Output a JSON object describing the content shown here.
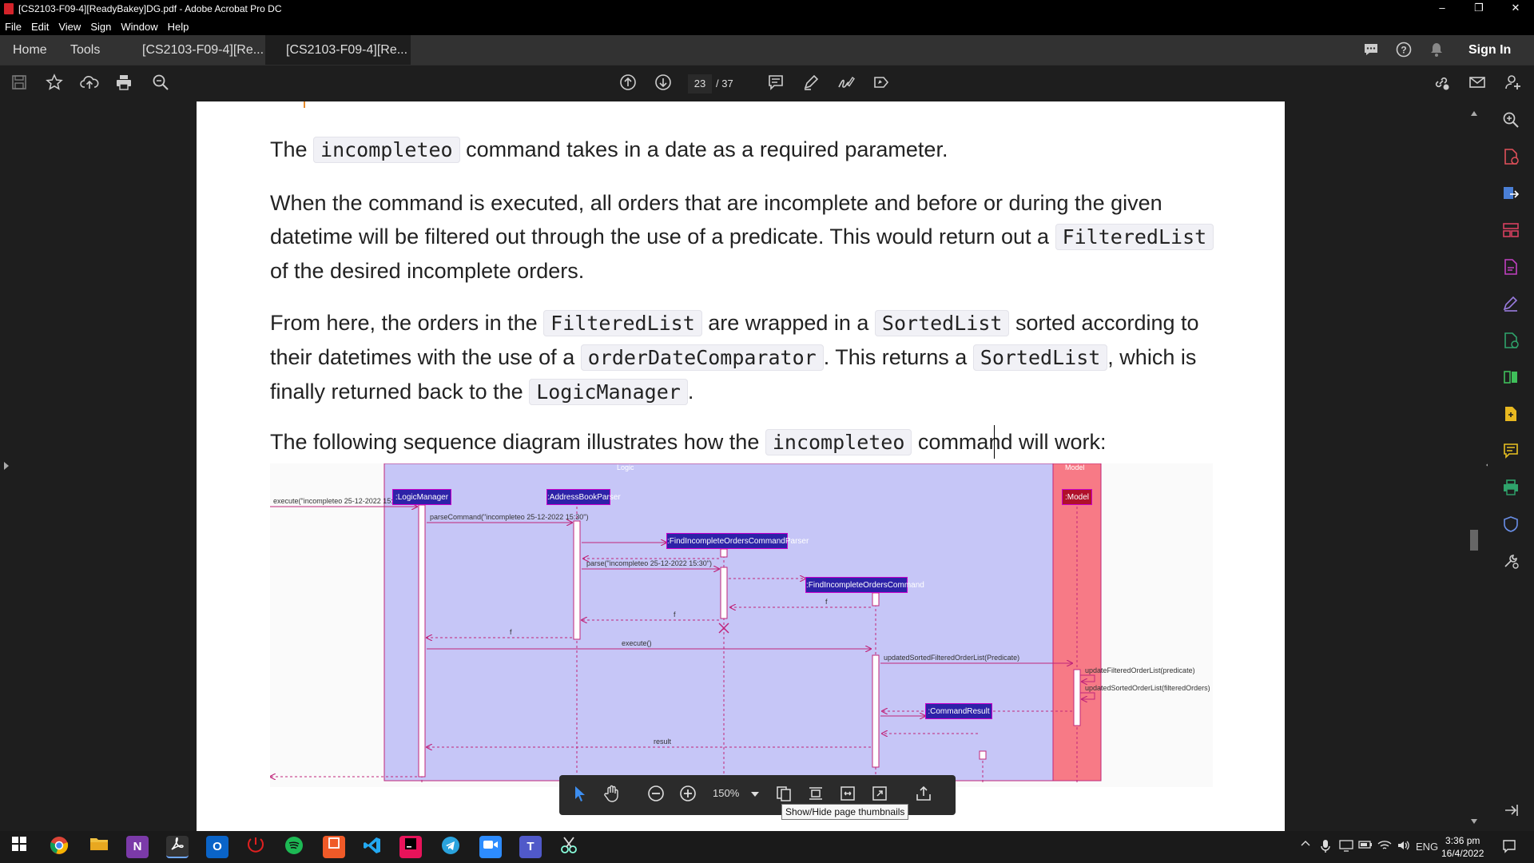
{
  "window": {
    "title": "[CS2103-F09-4][ReadyBakey]DG.pdf - Adobe Acrobat Pro DC",
    "controls": [
      "–",
      "❐",
      "✕"
    ]
  },
  "menu": [
    "File",
    "Edit",
    "View",
    "Sign",
    "Window",
    "Help"
  ],
  "tabs": {
    "home": "Home",
    "tools": "Tools",
    "doc1": "[CS2103-F09-4][Re...",
    "doc2": "[CS2103-F09-4][Re...",
    "close": "×",
    "sign_in": "Sign In"
  },
  "toolbar": {
    "page_current": "23",
    "page_total": "/ 37"
  },
  "document": {
    "p1": {
      "a": "The ",
      "code1": "incompleteo",
      "b": " command takes in a date as a required parameter."
    },
    "p2": {
      "a": "When the command is executed, all orders that are incomplete and before or during the given datetime will be filtered out through the use of a predicate. This would return out a ",
      "code1": "FilteredList",
      "b": " of the desired incomplete orders."
    },
    "p3": {
      "a": "From here, the orders in the ",
      "code1": "FilteredList",
      "b": " are wrapped in a ",
      "code2": "SortedList",
      "c": " sorted according to their datetimes with the use of a ",
      "code3": "orderDateComparator",
      "d": ". This returns a ",
      "code4": "SortedList",
      "e": ", which is finally returned back to the ",
      "code5": "LogicManager",
      "f": "."
    },
    "p4": {
      "a": "The following sequence diagram illustrates how the ",
      "code1": "incompleteo",
      "b": " command will work:"
    }
  },
  "diagram": {
    "logic_label": "Logic",
    "model_label": "Model",
    "lifelines": {
      "logic_manager": ":LogicManager",
      "parser": ":AddressBookParser",
      "cmd_parser": ":FindIncompleteOrdersCommandParser",
      "command": ":FindIncompleteOrdersCommand",
      "result": ":CommandResult",
      "model": ":Model"
    },
    "messages": {
      "m1": "execute(\"incompleteo 25-12-2022 15:30\")",
      "m2": "parseCommand(\"incompleteo 25-12-2022 15:30\")",
      "m3": "parse(\"incompleteo 25-12-2022 15:30\")",
      "r1": "f",
      "r2": "f",
      "r3": "f",
      "m4": "execute()",
      "m5": "updatedSortedFilteredOrderList(Predicate)",
      "m6": "updateFilteredOrderList(predicate)",
      "m7": "updatedSortedOrderList(filteredOrders)",
      "r4": "result"
    }
  },
  "floatbar": {
    "zoom": "150%",
    "tooltip": "Show/Hide page thumbnails"
  },
  "taskbar": {
    "lang": "ENG",
    "time": "3:36 pm",
    "date": "16/4/2022"
  },
  "colors": {
    "logic_bg": "#c6c6f7",
    "model_bg": "#f77a86",
    "lifeline_box": "#2d22a8",
    "arrow": "#c0257a"
  }
}
